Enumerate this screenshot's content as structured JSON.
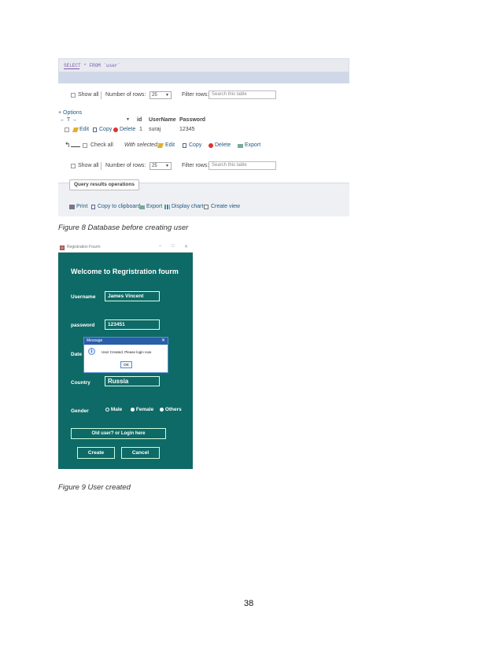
{
  "figure8": {
    "query": "SELECT * FROM `user`",
    "nav_top": {
      "show_all": "Show all",
      "number_of_rows_label": "Number of rows:",
      "rows_value": "25",
      "filter_label": "Filter rows:",
      "filter_placeholder": "Search this table"
    },
    "options_link": "+ Options",
    "columns": [
      "id",
      "UserName",
      "Password"
    ],
    "row": {
      "edit": "Edit",
      "copy": "Copy",
      "delete": "Delete",
      "id": "1",
      "username": "suraj",
      "password": "12345"
    },
    "bulk": {
      "check_all": "Check all",
      "with_selected": "With selected:",
      "edit": "Edit",
      "copy": "Copy",
      "delete": "Delete",
      "export": "Export"
    },
    "nav_bottom": {
      "show_all": "Show all",
      "number_of_rows_label": "Number of rows:",
      "rows_value": "25",
      "filter_label": "Filter rows:",
      "filter_placeholder": "Search this table"
    },
    "operations": {
      "title": "Query results operations",
      "print": "Print",
      "copy_clipboard": "Copy to clipboard",
      "export": "Export",
      "display_chart": "Display chart",
      "create_view": "Create view"
    }
  },
  "caption8": "Figure 8 Database before creating user",
  "figure9": {
    "window_title": "Registration Fourm",
    "heading": "Welcome to Regristration fourm",
    "username_label": "Username",
    "username_value": "James Vincent",
    "password_label": "password",
    "password_value": "123451",
    "date_label": "Date",
    "country_label": "Country",
    "country_value": "Russia",
    "gender_label": "Gender",
    "gender_options": [
      "Male",
      "Female",
      "Others"
    ],
    "login_link": "Old user? or Login here",
    "create_button": "Create",
    "cancel_button": "Cancel",
    "dialog": {
      "title": "Message",
      "text": "User Created, Please login now",
      "ok": "OK"
    }
  },
  "caption9": "Figure 9 User created",
  "page_number": "38"
}
